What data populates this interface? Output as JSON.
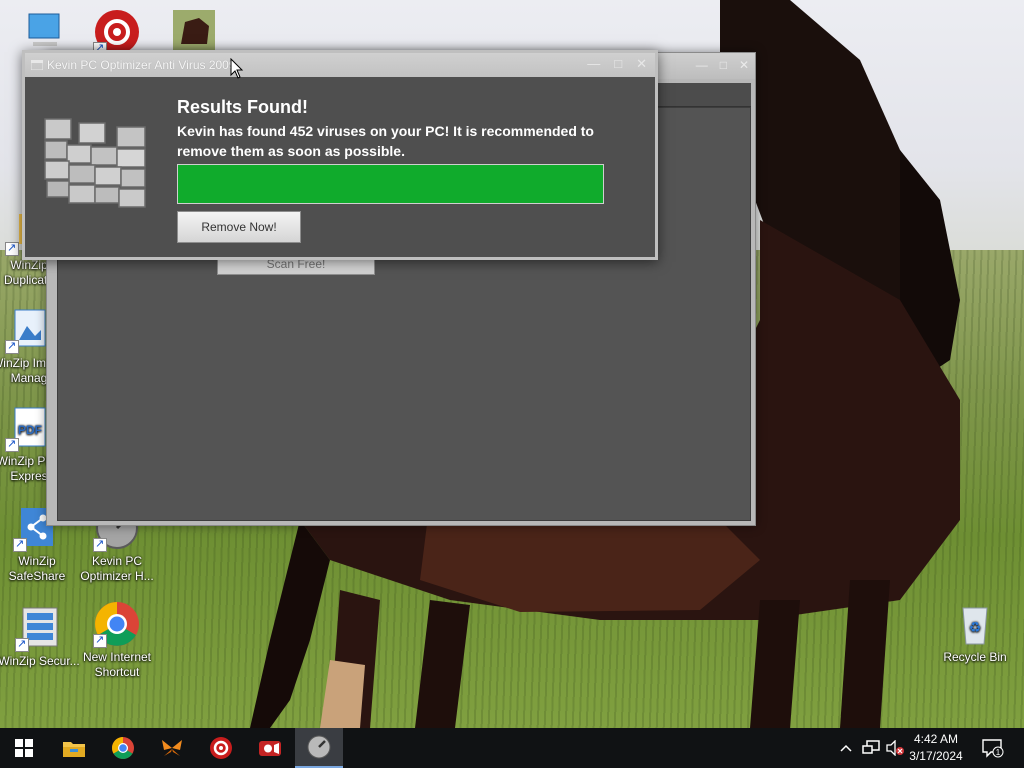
{
  "desktop": {
    "icons": [
      {
        "label": ""
      },
      {
        "label": ""
      },
      {
        "label": ""
      },
      {
        "label": "WinZip Duplicate"
      },
      {
        "label": "WinZip Image Manag"
      },
      {
        "label": "WinZip PDF Expres"
      },
      {
        "label": "WinZip SafeShare"
      },
      {
        "label": "Kevin PC Optimizer H..."
      },
      {
        "label": "WinZip Secur..."
      },
      {
        "label": "New Internet Shortcut"
      },
      {
        "label": "Recycle Bin"
      }
    ],
    "pdf_icon_text": "PDF"
  },
  "back_window": {
    "scan_button_label": "Scan Free!"
  },
  "dialog": {
    "title": "Kevin PC Optimizer Anti Virus 2009",
    "heading": "Results Found!",
    "message": "Kevin has found 452 viruses on your PC! It is recommended to remove them as soon as possible.",
    "progress_percent": 100,
    "progress_color": "#10ab2c",
    "remove_button_label": "Remove Now!"
  },
  "taskbar": {
    "items": [
      {
        "icon": "windows-start-icon"
      },
      {
        "icon": "file-explorer-icon"
      },
      {
        "icon": "chrome-icon"
      },
      {
        "icon": "butterfly-app-icon"
      },
      {
        "icon": "gear-app-icon"
      },
      {
        "icon": "video-recorder-icon"
      },
      {
        "icon": "optimizer-app-icon",
        "active": true
      }
    ],
    "tray": {
      "chevron_icon": "chevron-up-icon",
      "network_icon": "network-icon",
      "volume_icon": "volume-muted-icon",
      "notification_count": "1"
    },
    "clock": {
      "time": "4:42 AM",
      "date": "3/17/2024"
    }
  }
}
